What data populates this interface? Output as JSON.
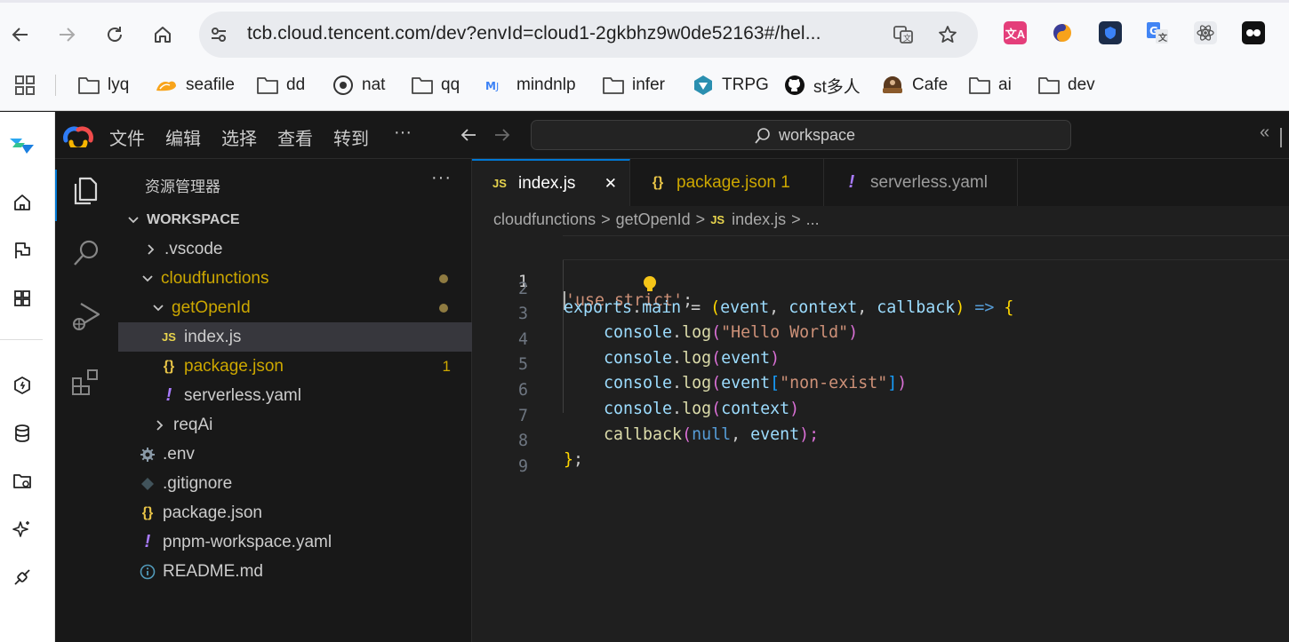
{
  "browser": {
    "url": "tcb.cloud.tencent.com/dev?envId=cloud1-2gkbhz9w0de52163#/hel...",
    "bookmarks": [
      {
        "label": "lyq",
        "icon": "folder-icon"
      },
      {
        "label": "seafile",
        "icon": "seafile-icon"
      },
      {
        "label": "dd",
        "icon": "folder-icon"
      },
      {
        "label": "nat",
        "icon": "record-icon"
      },
      {
        "label": "qq",
        "icon": "folder-icon"
      },
      {
        "label": "mindnlp",
        "icon": "mindnlp-icon"
      },
      {
        "label": "infer",
        "icon": "folder-icon"
      },
      {
        "label": "TRPG",
        "icon": "trpg-icon"
      },
      {
        "label": "st多人",
        "icon": "github-icon"
      },
      {
        "label": "Cafe",
        "icon": "cafe-icon"
      },
      {
        "label": "ai",
        "icon": "folder-icon"
      },
      {
        "label": "dev",
        "icon": "folder-icon"
      }
    ],
    "colors": {
      "accent": "#0078d4",
      "chrome_bg": "#f8f9fb"
    }
  },
  "ide": {
    "menu": [
      "文件",
      "编辑",
      "选择",
      "查看",
      "转到",
      "···"
    ],
    "command_center": "workspace",
    "explorer": {
      "title": "资源管理器",
      "more": "···",
      "workspace": "WORKSPACE",
      "items": [
        {
          "label": ".vscode"
        },
        {
          "label": "cloudfunctions"
        },
        {
          "label": "getOpenId"
        },
        {
          "label": "index.js",
          "icon": "JS"
        },
        {
          "label": "package.json",
          "icon": "{}",
          "badge": "1"
        },
        {
          "label": "serverless.yaml",
          "icon": "!"
        },
        {
          "label": "reqAi"
        },
        {
          "label": ".env"
        },
        {
          "label": ".gitignore"
        },
        {
          "label": "package.json",
          "icon": "{}"
        },
        {
          "label": "pnpm-workspace.yaml",
          "icon": "!"
        },
        {
          "label": "README.md"
        }
      ]
    },
    "tabs": [
      {
        "label": "index.js",
        "icon": "JS",
        "close": "✕"
      },
      {
        "label": "package.json 1",
        "icon": "{}"
      },
      {
        "label": "serverless.yaml",
        "icon": "!"
      }
    ],
    "breadcrumbs": [
      "cloudfunctions",
      "getOpenId",
      "JS",
      "index.js",
      "..."
    ],
    "breadcrumb_sep": ">",
    "line_numbers": [
      "1",
      "2",
      "3",
      "4",
      "5",
      "6",
      "7",
      "8",
      "9"
    ],
    "code": {
      "l1": [
        "'use strict'",
        ";"
      ],
      "l2": [
        "exports",
        ".",
        "main",
        " = ",
        "(",
        "event",
        ", ",
        "context",
        ", ",
        "callback",
        ")",
        " => ",
        "{"
      ],
      "l3": [
        "console",
        ".",
        "log",
        "(",
        "\"Hello World\"",
        ")"
      ],
      "l4": [
        "console",
        ".",
        "log",
        "(",
        "event",
        ")"
      ],
      "l5": [
        "console",
        ".",
        "log",
        "(",
        "event",
        "[",
        "\"non-exist\"",
        "]",
        ")"
      ],
      "l6": [
        "console",
        ".",
        "log",
        "(",
        "context",
        ")"
      ],
      "l7": [
        "callback",
        "(",
        "null",
        ", ",
        "event",
        ");"
      ],
      "l8": [
        "}",
        ";"
      ]
    }
  }
}
